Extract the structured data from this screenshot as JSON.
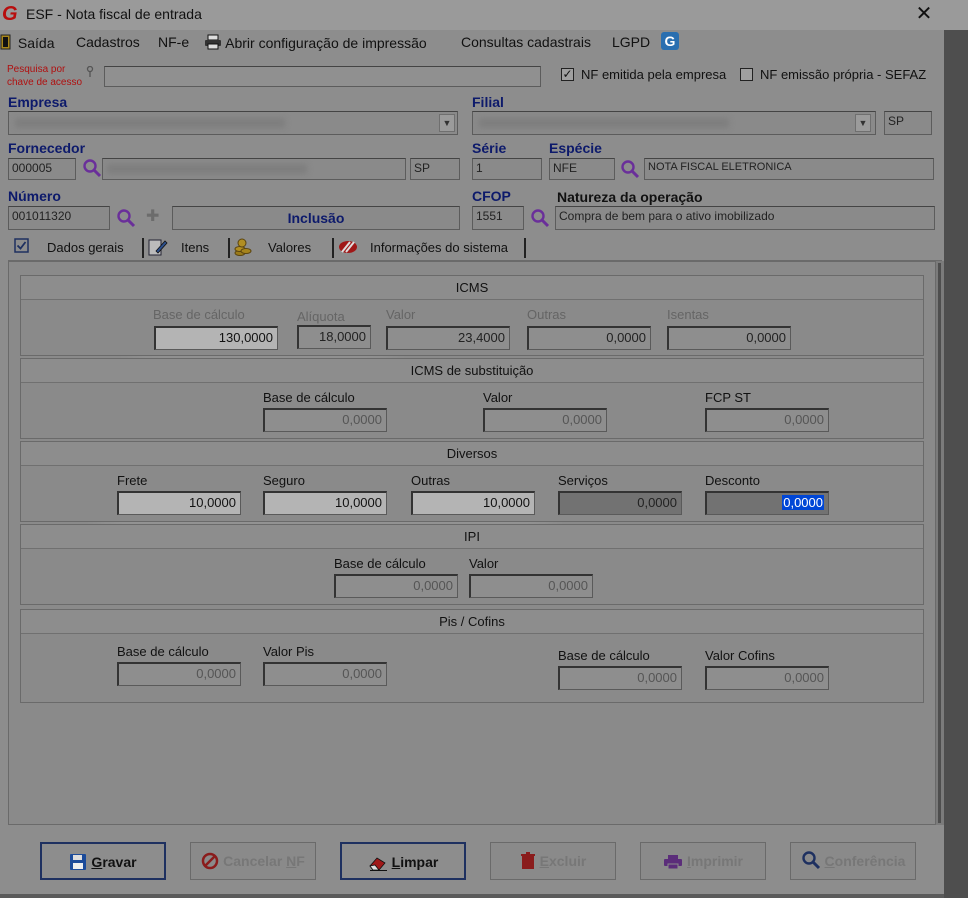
{
  "window": {
    "title": "ESF - Nota fiscal de entrada",
    "close": "✕"
  },
  "menu": {
    "items": [
      "Saída",
      "Cadastros",
      "NF-e",
      "Abrir configuração de impressão",
      "Consultas cadastrais",
      "LGPD"
    ]
  },
  "search": {
    "label_line1": "Pesquisa por",
    "label_line2": "chave de acesso",
    "value": ""
  },
  "options": {
    "nf_emitida_empresa": {
      "label": "NF emitida pela empresa",
      "checked": true,
      "mark": "✓"
    },
    "nf_emissao_propria": {
      "label": "NF emissão própria - SEFAZ",
      "checked": false,
      "mark": ""
    }
  },
  "header": {
    "empresa_label": "Empresa",
    "filial_label": "Filial",
    "filial_uf": "SP",
    "fornecedor_label": "Fornecedor",
    "fornecedor_code": "000005",
    "fornecedor_uf": "SP",
    "serie_label": "Série",
    "serie_value": "1",
    "especie_label": "Espécie",
    "especie_value": "NFE",
    "especie_desc": "NOTA FISCAL ELETRONICA",
    "numero_label": "Número",
    "numero_value": "001011320",
    "status": "Inclusão",
    "cfop_label": "CFOP",
    "cfop_value": "1551",
    "natureza_label": "Natureza da operação",
    "natureza_value": "Compra de bem para o ativo imobilizado"
  },
  "tabs": [
    "Dados gerais",
    "Itens",
    "Valores",
    "Informações do sistema"
  ],
  "icms": {
    "title": "ICMS",
    "labels": [
      "Base de cálculo",
      "Alíquota",
      "Valor",
      "Outras",
      "Isentas"
    ],
    "values": [
      "130,0000",
      "18,0000",
      "23,4000",
      "0,0000",
      "0,0000"
    ]
  },
  "icms_st": {
    "title": "ICMS de substituição",
    "labels": [
      "Base de cálculo",
      "Valor",
      "FCP ST"
    ],
    "values": [
      "0,0000",
      "0,0000",
      "0,0000"
    ]
  },
  "diversos": {
    "title": "Diversos",
    "labels": [
      "Frete",
      "Seguro",
      "Outras",
      "Serviços",
      "Desconto"
    ],
    "values": [
      "10,0000",
      "10,0000",
      "10,0000",
      "0,0000",
      "0,0000"
    ]
  },
  "ipi": {
    "title": "IPI",
    "labels": [
      "Base de cálculo",
      "Valor"
    ],
    "values": [
      "0,0000",
      "0,0000"
    ]
  },
  "pis_cofins": {
    "title": "Pis / Cofins",
    "labels": [
      "Base de cálculo",
      "Valor Pis",
      "Base de cálculo",
      "Valor Cofins"
    ],
    "values": [
      "0,0000",
      "0,0000",
      "0,0000",
      "0,0000"
    ]
  },
  "buttons": {
    "gravar": {
      "first": "G",
      "rest": "ravar"
    },
    "cancelar": {
      "pre": "Cancelar ",
      "u": "N",
      "post": "F"
    },
    "limpar": {
      "first": "L",
      "rest": "impar"
    },
    "excluir": {
      "first": "E",
      "rest": "xcluir"
    },
    "imprimir": {
      "first": "I",
      "rest": "mprimir"
    },
    "conferencia": {
      "first": "C",
      "rest": "onferência"
    }
  },
  "colors": {
    "accent_blue": "#0d1a6b",
    "label_red": "#b01010",
    "logo_red": "#b80e0e",
    "selection": "#0046d6"
  }
}
